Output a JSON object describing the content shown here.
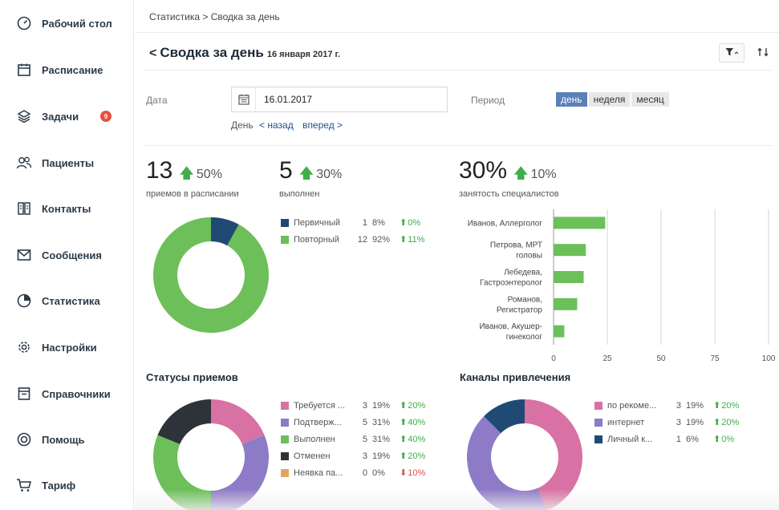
{
  "sidebar": {
    "items": [
      {
        "label": "Рабочий стол",
        "icon": "dashboard-gauge-icon"
      },
      {
        "label": "Расписание",
        "icon": "calendar-icon"
      },
      {
        "label": "Задачи",
        "icon": "layers-icon",
        "badge": "9"
      },
      {
        "label": "Пациенты",
        "icon": "users-icon"
      },
      {
        "label": "Контакты",
        "icon": "contacts-book-icon"
      },
      {
        "label": "Сообщения",
        "icon": "envelope-icon"
      },
      {
        "label": "Статистика",
        "icon": "pie-chart-icon"
      },
      {
        "label": "Настройки",
        "icon": "gear-icon"
      },
      {
        "label": "Справочники",
        "icon": "book-icon"
      },
      {
        "label": "Помощь",
        "icon": "lifebuoy-icon"
      },
      {
        "label": "Тариф",
        "icon": "cart-icon"
      }
    ]
  },
  "breadcrumb": "Статистика > Сводка за день",
  "header": {
    "back": "<",
    "title": "Сводка за день",
    "date": "16 января 2017 г.",
    "filter_icon": "filter-icon",
    "swap_icon": "swap-icon"
  },
  "filters": {
    "date_label": "Дата",
    "date_value": "16.01.2017",
    "day_label": "День",
    "back_link": "< назад",
    "forward_link": "вперед >",
    "period_label": "Период",
    "period_options": [
      "день",
      "неделя",
      "месяц"
    ],
    "period_selected": "день"
  },
  "kpis": [
    {
      "value": "13",
      "change": "50%",
      "label": "приемов в расписании"
    },
    {
      "value": "5",
      "change": "30%",
      "label": "выполнен"
    },
    {
      "value": "30%",
      "change": "10%",
      "label": "занятость специалистов"
    }
  ],
  "colors": {
    "green": "#6cbf59",
    "navy": "#1f4a73",
    "pink": "#d872a4",
    "purple": "#8e7bc8",
    "dark": "#2d3339",
    "orange": "#e0a660",
    "up": "#3fae49",
    "down": "#d9534f",
    "accent": "#5b7fb8"
  },
  "visit_types": [
    {
      "name": "Первичный",
      "count": "1",
      "pct": "8%",
      "trend": "0%",
      "dir": "up",
      "color": "#1f4a73"
    },
    {
      "name": "Повторный",
      "count": "12",
      "pct": "92%",
      "trend": "11%",
      "dir": "up",
      "color": "#6cbf59"
    }
  ],
  "statuses_title": "Статусы приемов",
  "statuses": [
    {
      "name": "Требуется ...",
      "count": "3",
      "pct": "19%",
      "trend": "20%",
      "dir": "up",
      "color": "#d872a4"
    },
    {
      "name": "Подтверж...",
      "count": "5",
      "pct": "31%",
      "trend": "40%",
      "dir": "up",
      "color": "#8e7bc8"
    },
    {
      "name": "Выполнен",
      "count": "5",
      "pct": "31%",
      "trend": "40%",
      "dir": "up",
      "color": "#6cbf59"
    },
    {
      "name": "Отменен",
      "count": "3",
      "pct": "19%",
      "trend": "20%",
      "dir": "up",
      "color": "#2d3339"
    },
    {
      "name": "Неявка па...",
      "count": "0",
      "pct": "0%",
      "trend": "10%",
      "dir": "down",
      "color": "#e0a660"
    }
  ],
  "channels_title": "Каналы привлечения",
  "channels": [
    {
      "name": "по рекоме...",
      "count": "3",
      "pct": "19%",
      "trend": "20%",
      "dir": "up",
      "color": "#d872a4"
    },
    {
      "name": "интернет",
      "count": "3",
      "pct": "19%",
      "trend": "20%",
      "dir": "up",
      "color": "#8e7bc8"
    },
    {
      "name": "Личный к...",
      "count": "1",
      "pct": "6%",
      "trend": "0%",
      "dir": "up",
      "color": "#1f4a73"
    }
  ],
  "chart_data": [
    {
      "type": "pie",
      "labels": [
        "Первичный",
        "Повторный"
      ],
      "values": [
        8,
        92
      ],
      "colors": [
        "#1f4a73",
        "#6cbf59"
      ],
      "donut": true
    },
    {
      "type": "bar",
      "orientation": "horizontal",
      "categories": [
        "Иванов, Аллерголог",
        "Петрова, МРТ головы",
        "Лебедева, Гастроэнтеролог",
        "Романов, Регистратор",
        "Иванов, Акушер-гинеколог"
      ],
      "category_lines": [
        [
          "Иванов, Аллерголог"
        ],
        [
          "Петрова, МРТ",
          "головы"
        ],
        [
          "Лебедева,",
          "Гастроэнтеролог"
        ],
        [
          "Романов,",
          "Регистратор"
        ],
        [
          "Иванов, Акушер-",
          "гинеколог"
        ]
      ],
      "values": [
        24,
        15,
        14,
        11,
        5
      ],
      "xlim": [
        0,
        100
      ],
      "xticks": [
        0,
        25,
        50,
        75,
        100
      ],
      "color": "#6cbf59",
      "grid": true
    },
    {
      "type": "pie",
      "title": "Статусы приемов",
      "labels": [
        "Требуется ...",
        "Подтверж...",
        "Выполнен",
        "Отменен",
        "Неявка па..."
      ],
      "values": [
        3,
        5,
        5,
        3,
        0
      ],
      "colors": [
        "#d872a4",
        "#8e7bc8",
        "#6cbf59",
        "#2d3339",
        "#e0a660"
      ],
      "donut": true
    },
    {
      "type": "pie",
      "title": "Каналы привлечения",
      "labels": [
        "по рекоме...",
        "интернет",
        "Личный к..."
      ],
      "values": [
        7,
        7,
        2
      ],
      "colors": [
        "#d872a4",
        "#8e7bc8",
        "#1f4a73"
      ],
      "donut": true
    }
  ]
}
